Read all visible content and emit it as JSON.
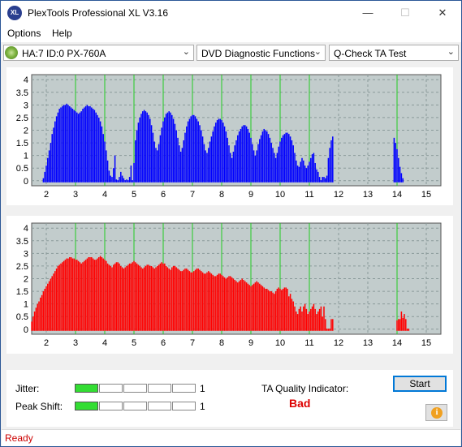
{
  "window": {
    "title": "PlexTools Professional XL V3.16",
    "icon_text": "XL",
    "minimize_symbol": "—",
    "maximize_symbol": "☐",
    "close_symbol": "✕"
  },
  "menu": {
    "items": [
      "Options",
      "Help"
    ]
  },
  "toolbar": {
    "drive": "HA:7 ID:0  PX-760A",
    "function": "DVD Diagnostic Functions",
    "test": "Q-Check TA Test"
  },
  "colors": {
    "chart_bg": "#c2cccc",
    "top_series": "#0000ff",
    "bottom_series": "#ff0000",
    "green_line": "#22cc22",
    "meter_on": "#33dd33",
    "quality_bad": "#dd0000"
  },
  "chart_data": [
    {
      "type": "bar",
      "series_color": "#0000ff",
      "xlim": [
        1.5,
        15.5
      ],
      "ylim": [
        -0.2,
        4.2
      ],
      "xticks": [
        2,
        3,
        4,
        5,
        6,
        7,
        8,
        9,
        10,
        11,
        12,
        13,
        14,
        15
      ],
      "yticks": [
        0,
        0.5,
        1,
        1.5,
        2,
        2.5,
        3,
        3.5,
        4
      ],
      "vertical_markers": [
        3,
        4,
        5,
        6,
        7,
        8,
        9,
        10,
        11,
        14
      ],
      "grid": true,
      "bars": {
        "x": [
          1.9,
          1.95,
          2.0,
          2.05,
          2.1,
          2.15,
          2.2,
          2.25,
          2.3,
          2.35,
          2.4,
          2.45,
          2.5,
          2.55,
          2.6,
          2.65,
          2.7,
          2.75,
          2.8,
          2.85,
          2.9,
          2.95,
          3.0,
          3.05,
          3.1,
          3.15,
          3.2,
          3.25,
          3.3,
          3.35,
          3.4,
          3.45,
          3.5,
          3.55,
          3.6,
          3.65,
          3.7,
          3.75,
          3.8,
          3.85,
          3.9,
          3.95,
          4.0,
          4.05,
          4.1,
          4.15,
          4.2,
          4.25,
          4.3,
          4.35,
          4.4,
          4.45,
          4.5,
          4.55,
          4.6,
          4.65,
          4.7,
          4.75,
          4.8,
          4.85,
          4.9,
          4.95,
          5.0,
          5.05,
          5.1,
          5.15,
          5.2,
          5.25,
          5.3,
          5.35,
          5.4,
          5.45,
          5.5,
          5.55,
          5.6,
          5.65,
          5.7,
          5.75,
          5.8,
          5.85,
          5.9,
          5.95,
          6.0,
          6.05,
          6.1,
          6.15,
          6.2,
          6.25,
          6.3,
          6.35,
          6.4,
          6.45,
          6.5,
          6.55,
          6.6,
          6.65,
          6.7,
          6.75,
          6.8,
          6.85,
          6.9,
          6.95,
          7.0,
          7.05,
          7.1,
          7.15,
          7.2,
          7.25,
          7.3,
          7.35,
          7.4,
          7.45,
          7.5,
          7.55,
          7.6,
          7.65,
          7.7,
          7.75,
          7.8,
          7.85,
          7.9,
          7.95,
          8.0,
          8.05,
          8.1,
          8.15,
          8.2,
          8.25,
          8.3,
          8.35,
          8.4,
          8.45,
          8.5,
          8.55,
          8.6,
          8.65,
          8.7,
          8.75,
          8.8,
          8.85,
          8.9,
          8.95,
          9.0,
          9.05,
          9.1,
          9.15,
          9.2,
          9.25,
          9.3,
          9.35,
          9.4,
          9.45,
          9.5,
          9.55,
          9.6,
          9.65,
          9.7,
          9.75,
          9.8,
          9.85,
          9.9,
          9.95,
          10.0,
          10.05,
          10.1,
          10.15,
          10.2,
          10.25,
          10.3,
          10.35,
          10.4,
          10.45,
          10.5,
          10.55,
          10.6,
          10.65,
          10.7,
          10.75,
          10.8,
          10.85,
          10.9,
          10.95,
          11.0,
          11.05,
          11.1,
          11.15,
          11.2,
          11.25,
          11.3,
          11.35,
          11.4,
          11.45,
          11.5,
          11.55,
          11.6,
          11.65,
          11.7,
          11.75,
          11.8,
          13.9,
          13.95,
          14.0,
          14.05,
          14.1,
          14.15,
          14.2,
          14.25,
          14.3,
          14.35,
          14.4,
          14.45,
          14.5,
          14.55,
          14.6
        ],
        "y": [
          0.1,
          0.35,
          0.6,
          0.9,
          1.2,
          1.5,
          1.85,
          2.1,
          2.35,
          2.55,
          2.7,
          2.85,
          2.9,
          2.95,
          3.0,
          3.0,
          3.05,
          3.0,
          2.95,
          2.9,
          2.85,
          2.8,
          2.75,
          2.7,
          2.65,
          2.7,
          2.75,
          2.85,
          2.9,
          2.95,
          3.0,
          2.95,
          2.95,
          2.9,
          2.85,
          2.8,
          2.7,
          2.6,
          2.5,
          2.35,
          2.15,
          1.85,
          1.55,
          1.2,
          0.8,
          0.4,
          0.2,
          0.15,
          0.5,
          1.0,
          0.05,
          0.0,
          0.15,
          0.35,
          0.2,
          0.1,
          0.0,
          0.05,
          0.0,
          0.15,
          0.6,
          0.0,
          0.7,
          1.6,
          2.0,
          2.3,
          2.5,
          2.65,
          2.75,
          2.8,
          2.75,
          2.7,
          2.6,
          2.45,
          2.2,
          1.9,
          1.55,
          1.3,
          1.2,
          1.45,
          1.8,
          2.1,
          2.35,
          2.5,
          2.65,
          2.7,
          2.75,
          2.7,
          2.6,
          2.45,
          2.25,
          2.0,
          1.7,
          1.4,
          1.15,
          1.3,
          1.6,
          1.9,
          2.15,
          2.35,
          2.45,
          2.55,
          2.6,
          2.6,
          2.55,
          2.45,
          2.35,
          2.2,
          2.0,
          1.75,
          1.45,
          1.2,
          1.1,
          1.3,
          1.55,
          1.75,
          1.95,
          2.15,
          2.3,
          2.4,
          2.45,
          2.45,
          2.4,
          2.3,
          2.15,
          1.95,
          1.7,
          1.4,
          1.1,
          0.9,
          1.15,
          1.4,
          1.6,
          1.8,
          1.95,
          2.05,
          2.15,
          2.2,
          2.2,
          2.15,
          2.05,
          1.9,
          1.7,
          1.45,
          1.2,
          1.0,
          1.2,
          1.45,
          1.65,
          1.8,
          1.95,
          2.05,
          2.0,
          1.95,
          1.85,
          1.7,
          1.5,
          1.3,
          1.1,
          0.9,
          1.1,
          1.35,
          1.55,
          1.7,
          1.8,
          1.85,
          1.9,
          1.9,
          1.85,
          1.75,
          1.6,
          1.4,
          1.1,
          0.8,
          0.6,
          0.55,
          0.75,
          0.9,
          0.8,
          0.6,
          0.5,
          0.6,
          0.75,
          0.9,
          1.05,
          1.1,
          0.7,
          0.45,
          0.35,
          0.15,
          0.0,
          0.15,
          0.15,
          0.1,
          0.2,
          0.9,
          1.3,
          1.6,
          1.75,
          1.7,
          1.5,
          1.25,
          0.9,
          0.55,
          0.3,
          0.1
        ]
      }
    },
    {
      "type": "bar",
      "series_color": "#ff0000",
      "xlim": [
        1.5,
        15.5
      ],
      "ylim": [
        -0.2,
        4.2
      ],
      "xticks": [
        2,
        3,
        4,
        5,
        6,
        7,
        8,
        9,
        10,
        11,
        12,
        13,
        14,
        15
      ],
      "yticks": [
        0,
        0.5,
        1,
        1.5,
        2,
        2.5,
        3,
        3.5,
        4
      ],
      "vertical_markers": [
        3,
        4,
        5,
        6,
        7,
        8,
        9,
        10,
        11,
        14
      ],
      "grid": true,
      "bars": {
        "x": [
          1.5,
          1.55,
          1.6,
          1.65,
          1.7,
          1.75,
          1.8,
          1.85,
          1.9,
          1.95,
          2.0,
          2.05,
          2.1,
          2.15,
          2.2,
          2.25,
          2.3,
          2.35,
          2.4,
          2.45,
          2.5,
          2.55,
          2.6,
          2.65,
          2.7,
          2.75,
          2.8,
          2.85,
          2.9,
          2.95,
          3.0,
          3.05,
          3.1,
          3.15,
          3.2,
          3.25,
          3.3,
          3.35,
          3.4,
          3.45,
          3.5,
          3.55,
          3.6,
          3.65,
          3.7,
          3.75,
          3.8,
          3.85,
          3.9,
          3.95,
          4.0,
          4.05,
          4.1,
          4.15,
          4.2,
          4.25,
          4.3,
          4.35,
          4.4,
          4.45,
          4.5,
          4.55,
          4.6,
          4.65,
          4.7,
          4.75,
          4.8,
          4.85,
          4.9,
          4.95,
          5.0,
          5.05,
          5.1,
          5.15,
          5.2,
          5.25,
          5.3,
          5.35,
          5.4,
          5.45,
          5.5,
          5.55,
          5.6,
          5.65,
          5.7,
          5.75,
          5.8,
          5.85,
          5.9,
          5.95,
          6.0,
          6.05,
          6.1,
          6.15,
          6.2,
          6.25,
          6.3,
          6.35,
          6.4,
          6.45,
          6.5,
          6.55,
          6.6,
          6.65,
          6.7,
          6.75,
          6.8,
          6.85,
          6.9,
          6.95,
          7.0,
          7.05,
          7.1,
          7.15,
          7.2,
          7.25,
          7.3,
          7.35,
          7.4,
          7.45,
          7.5,
          7.55,
          7.6,
          7.65,
          7.7,
          7.75,
          7.8,
          7.85,
          7.9,
          7.95,
          8.0,
          8.05,
          8.1,
          8.15,
          8.2,
          8.25,
          8.3,
          8.35,
          8.4,
          8.45,
          8.5,
          8.55,
          8.6,
          8.65,
          8.7,
          8.75,
          8.8,
          8.85,
          8.9,
          8.95,
          9.0,
          9.05,
          9.1,
          9.15,
          9.2,
          9.25,
          9.3,
          9.35,
          9.4,
          9.45,
          9.5,
          9.55,
          9.6,
          9.65,
          9.7,
          9.75,
          9.8,
          9.85,
          9.9,
          9.95,
          10.0,
          10.05,
          10.1,
          10.15,
          10.2,
          10.25,
          10.3,
          10.35,
          10.4,
          10.45,
          10.5,
          10.55,
          10.6,
          10.65,
          10.7,
          10.75,
          10.8,
          10.85,
          10.9,
          10.95,
          11.0,
          11.05,
          11.1,
          11.15,
          11.2,
          11.25,
          11.3,
          11.35,
          11.4,
          11.45,
          11.5,
          11.55,
          11.6,
          11.65,
          11.7,
          11.75,
          11.8,
          14.0,
          14.05,
          14.1,
          14.15,
          14.2,
          14.25,
          14.3,
          14.35,
          14.4,
          14.45,
          14.5,
          14.55,
          14.6
        ],
        "y": [
          0.3,
          0.5,
          0.7,
          0.85,
          1.0,
          1.1,
          1.25,
          1.35,
          1.5,
          1.6,
          1.7,
          1.8,
          1.9,
          2.0,
          2.1,
          2.2,
          2.3,
          2.4,
          2.5,
          2.55,
          2.6,
          2.65,
          2.7,
          2.75,
          2.8,
          2.8,
          2.85,
          2.85,
          2.8,
          2.8,
          2.75,
          2.75,
          2.7,
          2.65,
          2.6,
          2.65,
          2.7,
          2.75,
          2.8,
          2.85,
          2.85,
          2.85,
          2.8,
          2.75,
          2.75,
          2.8,
          2.85,
          2.9,
          2.85,
          2.8,
          2.75,
          2.7,
          2.6,
          2.55,
          2.5,
          2.45,
          2.55,
          2.6,
          2.65,
          2.65,
          2.6,
          2.5,
          2.45,
          2.4,
          2.45,
          2.5,
          2.55,
          2.6,
          2.6,
          2.65,
          2.7,
          2.65,
          2.6,
          2.55,
          2.5,
          2.45,
          2.4,
          2.45,
          2.5,
          2.55,
          2.55,
          2.5,
          2.5,
          2.45,
          2.4,
          2.45,
          2.5,
          2.55,
          2.6,
          2.65,
          2.6,
          2.6,
          2.5,
          2.45,
          2.4,
          2.35,
          2.45,
          2.5,
          2.5,
          2.45,
          2.4,
          2.35,
          2.3,
          2.3,
          2.35,
          2.4,
          2.4,
          2.35,
          2.3,
          2.25,
          2.25,
          2.3,
          2.35,
          2.4,
          2.4,
          2.35,
          2.3,
          2.25,
          2.2,
          2.2,
          2.25,
          2.3,
          2.25,
          2.2,
          2.15,
          2.1,
          2.1,
          2.15,
          2.2,
          2.2,
          2.15,
          2.1,
          2.05,
          2.0,
          2.05,
          2.1,
          2.1,
          2.05,
          2.0,
          1.95,
          1.9,
          1.85,
          1.9,
          1.95,
          2.0,
          1.95,
          1.9,
          1.85,
          1.8,
          1.75,
          1.7,
          1.75,
          1.8,
          1.85,
          1.9,
          1.85,
          1.8,
          1.75,
          1.7,
          1.65,
          1.6,
          1.6,
          1.55,
          1.5,
          1.5,
          1.45,
          1.4,
          1.5,
          1.6,
          1.65,
          1.6,
          1.55,
          1.6,
          1.65,
          1.65,
          1.6,
          1.3,
          1.4,
          1.2,
          1.1,
          0.9,
          0.7,
          0.6,
          0.8,
          0.9,
          0.7,
          0.9,
          1.0,
          0.8,
          0.6,
          0.7,
          0.8,
          0.9,
          1.0,
          0.8,
          0.6,
          0.7,
          0.8,
          0.9,
          0.5,
          0.9,
          0.4,
          0.0,
          0.0,
          0.0,
          0.4,
          0.4,
          0.35,
          0.4,
          0.4,
          0.7,
          0.45,
          0.6,
          0.4,
          0.0,
          0.0
        ]
      }
    }
  ],
  "results": {
    "jitter_label": "Jitter:",
    "jitter_value": "1",
    "jitter_level": 1,
    "peak_shift_label": "Peak Shift:",
    "peak_shift_value": "1",
    "peak_shift_level": 1,
    "meter_segments": 5,
    "ta_quality_label": "TA Quality Indicator:",
    "ta_quality_value": "Bad",
    "start_label": "Start",
    "info_symbol": "i"
  },
  "status": {
    "text": "Ready"
  }
}
